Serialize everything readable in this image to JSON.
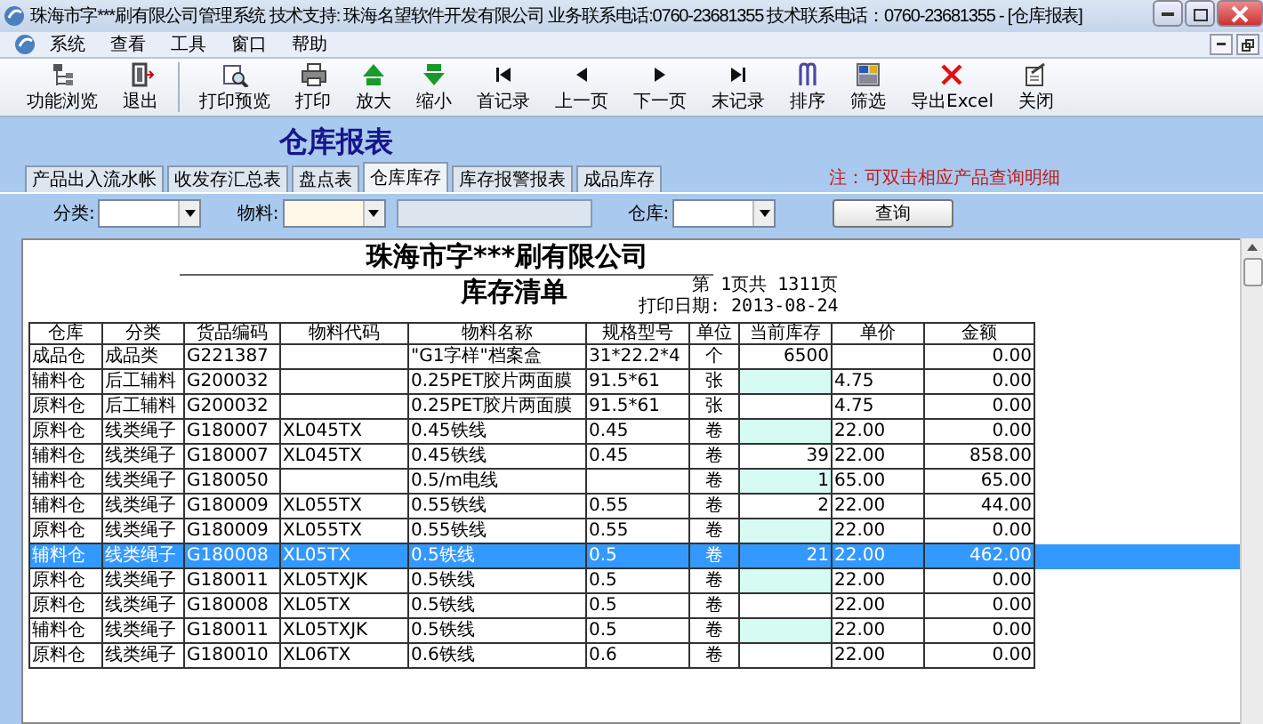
{
  "window": {
    "title": "珠海市字***刷有限公司管理系统  技术支持: 珠海名望软件开发有限公司  业务联系电话:0760-23681355  技术联系电话：0760-23681355 - [仓库报表]"
  },
  "menu": [
    "系统",
    "查看",
    "工具",
    "窗口",
    "帮助"
  ],
  "toolbar": [
    "功能浏览",
    "退出",
    "打印预览",
    "打印",
    "放大",
    "缩小",
    "首记录",
    "上一页",
    "下一页",
    "末记录",
    "排序",
    "筛选",
    "导出Excel",
    "关闭"
  ],
  "panel_title": "仓库报表",
  "tabs": [
    {
      "label": "产品出入流水帐",
      "selected": false
    },
    {
      "label": "收发存汇总表",
      "selected": false
    },
    {
      "label": "盘点表",
      "selected": false
    },
    {
      "label": "仓库库存",
      "selected": true
    },
    {
      "label": "库存报警报表",
      "selected": false
    },
    {
      "label": "成品库存",
      "selected": false
    }
  ],
  "note": "注：可双击相应产品查询明细",
  "filters": [
    {
      "kind": "dropdown",
      "label": "分类:"
    },
    {
      "kind": "dropdown",
      "label": "物料:"
    },
    {
      "kind": "text"
    },
    {
      "kind": "dropdown",
      "label": "仓库:"
    }
  ],
  "query_button": "查询",
  "report": {
    "company": "珠海市字***刷有限公司",
    "title": "库存清单",
    "page_info": "第 1页共 1311页",
    "print_date": "打印日期: 2013-08-24",
    "columns": [
      "仓库",
      "分类",
      "货品编码",
      "物料代码",
      "物料名称",
      "规格型号",
      "单位",
      "当前库存",
      "单价",
      "金额"
    ],
    "rows": [
      {
        "cells": [
          "成品仓",
          "成品类",
          "G221387",
          "",
          "\"G1字样\"档案盒",
          "31*22.2*4",
          "个",
          "6500",
          "",
          "0.00"
        ],
        "selected": false,
        "stock_highlight": false
      },
      {
        "cells": [
          "辅料仓",
          "后工辅料",
          "G200032",
          "",
          "0.25PET胶片两面膜",
          "91.5*61",
          "张",
          "",
          "4.75",
          "0.00"
        ],
        "selected": false,
        "stock_highlight": true
      },
      {
        "cells": [
          "原料仓",
          "后工辅料",
          "G200032",
          "",
          "0.25PET胶片两面膜",
          "91.5*61",
          "张",
          "",
          "4.75",
          "0.00"
        ],
        "selected": false,
        "stock_highlight": false
      },
      {
        "cells": [
          "原料仓",
          "线类绳子",
          "G180007",
          "XL045TX",
          "0.45铁线",
          "0.45",
          "卷",
          "",
          "22.00",
          "0.00"
        ],
        "selected": false,
        "stock_highlight": true
      },
      {
        "cells": [
          "辅料仓",
          "线类绳子",
          "G180007",
          "XL045TX",
          "0.45铁线",
          "0.45",
          "卷",
          "39",
          "22.00",
          "858.00"
        ],
        "selected": false,
        "stock_highlight": false
      },
      {
        "cells": [
          "辅料仓",
          "线类绳子",
          "G180050",
          "",
          "0.5/m电线",
          "",
          "卷",
          "1",
          "65.00",
          "65.00"
        ],
        "selected": false,
        "stock_highlight": true
      },
      {
        "cells": [
          "辅料仓",
          "线类绳子",
          "G180009",
          "XL055TX",
          "0.55铁线",
          "0.55",
          "卷",
          "2",
          "22.00",
          "44.00"
        ],
        "selected": false,
        "stock_highlight": false
      },
      {
        "cells": [
          "原料仓",
          "线类绳子",
          "G180009",
          "XL055TX",
          "0.55铁线",
          "0.55",
          "卷",
          "",
          "22.00",
          "0.00"
        ],
        "selected": false,
        "stock_highlight": true
      },
      {
        "cells": [
          "辅料仓",
          "线类绳子",
          "G180008",
          "XL05TX",
          "0.5铁线",
          "0.5",
          "卷",
          "21",
          "22.00",
          "462.00"
        ],
        "selected": true,
        "stock_highlight": false
      },
      {
        "cells": [
          "原料仓",
          "线类绳子",
          "G180011",
          "XL05TXJK",
          "0.5铁线",
          "0.5",
          "卷",
          "",
          "22.00",
          "0.00"
        ],
        "selected": false,
        "stock_highlight": true
      },
      {
        "cells": [
          "原料仓",
          "线类绳子",
          "G180008",
          "XL05TX",
          "0.5铁线",
          "0.5",
          "卷",
          "",
          "22.00",
          "0.00"
        ],
        "selected": false,
        "stock_highlight": false
      },
      {
        "cells": [
          "辅料仓",
          "线类绳子",
          "G180011",
          "XL05TXJK",
          "0.5铁线",
          "0.5",
          "卷",
          "",
          "22.00",
          "0.00"
        ],
        "selected": false,
        "stock_highlight": true
      },
      {
        "cells": [
          "原料仓",
          "线类绳子",
          "G180010",
          "XL06TX",
          "0.6铁线",
          "0.6",
          "卷",
          "",
          "22.00",
          "0.00"
        ],
        "selected": false,
        "stock_highlight": false
      }
    ]
  }
}
